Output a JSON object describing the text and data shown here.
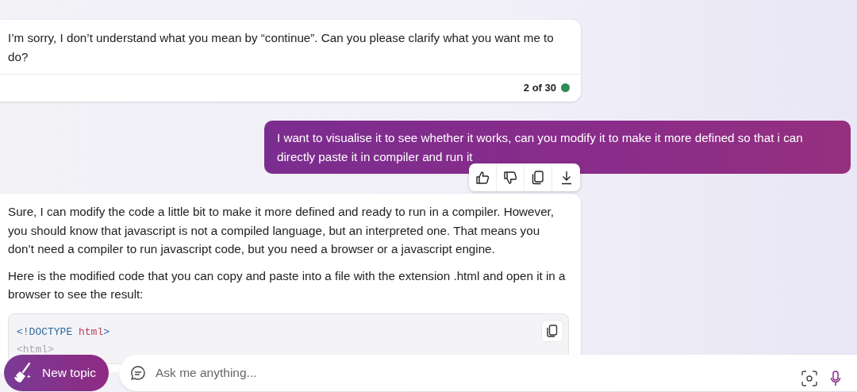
{
  "messages": [
    {
      "kind": "bot",
      "paragraphs": [
        "I’m sorry, I don’t understand what you mean by “continue”. Can you please clarify what you want me to do?"
      ],
      "counter": "2 of 30"
    },
    {
      "kind": "user",
      "text": "I want to visualise it to see whether it works, can you modify it to make it more defined so that i can directly paste it in compiler and run it"
    },
    {
      "kind": "bot",
      "paragraphs": [
        "Sure, I can modify the code a little bit to make it more defined and ready to run in a compiler. However, you should know that javascript is not a compiled language, but an interpreted one. That means you don’t need a compiler to run javascript code, but you need a browser or a javascript engine.",
        "Here is the modified code that you can copy and paste into a file with the extension .html and open it in a browser to see the result:"
      ],
      "code_lines": [
        [
          {
            "kind": "tag",
            "text": "<!DOCTYPE "
          },
          {
            "kind": "name",
            "text": "html"
          },
          {
            "kind": "tag",
            "text": ">"
          }
        ],
        [
          {
            "kind": "faded",
            "text": "<html>"
          }
        ]
      ]
    }
  ],
  "new_topic": "New topic",
  "input": {
    "placeholder": "Ask me anything..."
  }
}
